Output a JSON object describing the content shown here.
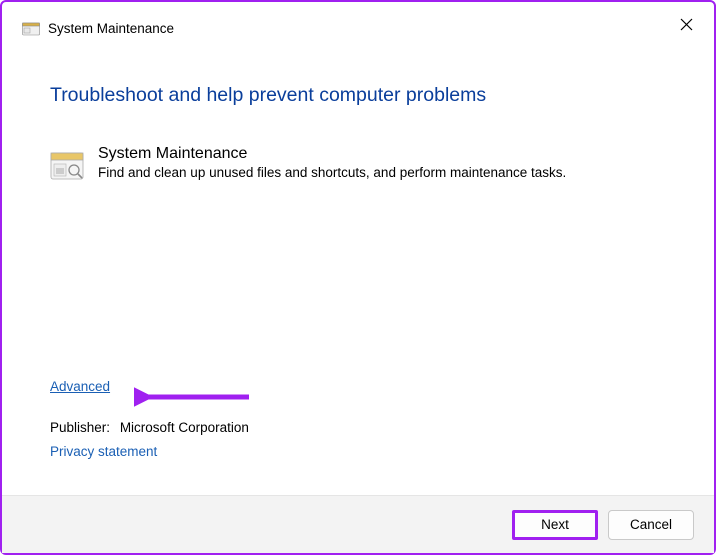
{
  "header": {
    "title": "System Maintenance"
  },
  "main": {
    "heading": "Troubleshoot and help prevent computer problems",
    "troubleshooter": {
      "name": "System Maintenance",
      "description": "Find and clean up unused files and shortcuts, and perform maintenance tasks."
    }
  },
  "links": {
    "advanced": "Advanced",
    "privacy": "Privacy statement"
  },
  "publisher": {
    "label": "Publisher:",
    "value": "Microsoft Corporation"
  },
  "buttons": {
    "next": "Next",
    "cancel": "Cancel"
  }
}
